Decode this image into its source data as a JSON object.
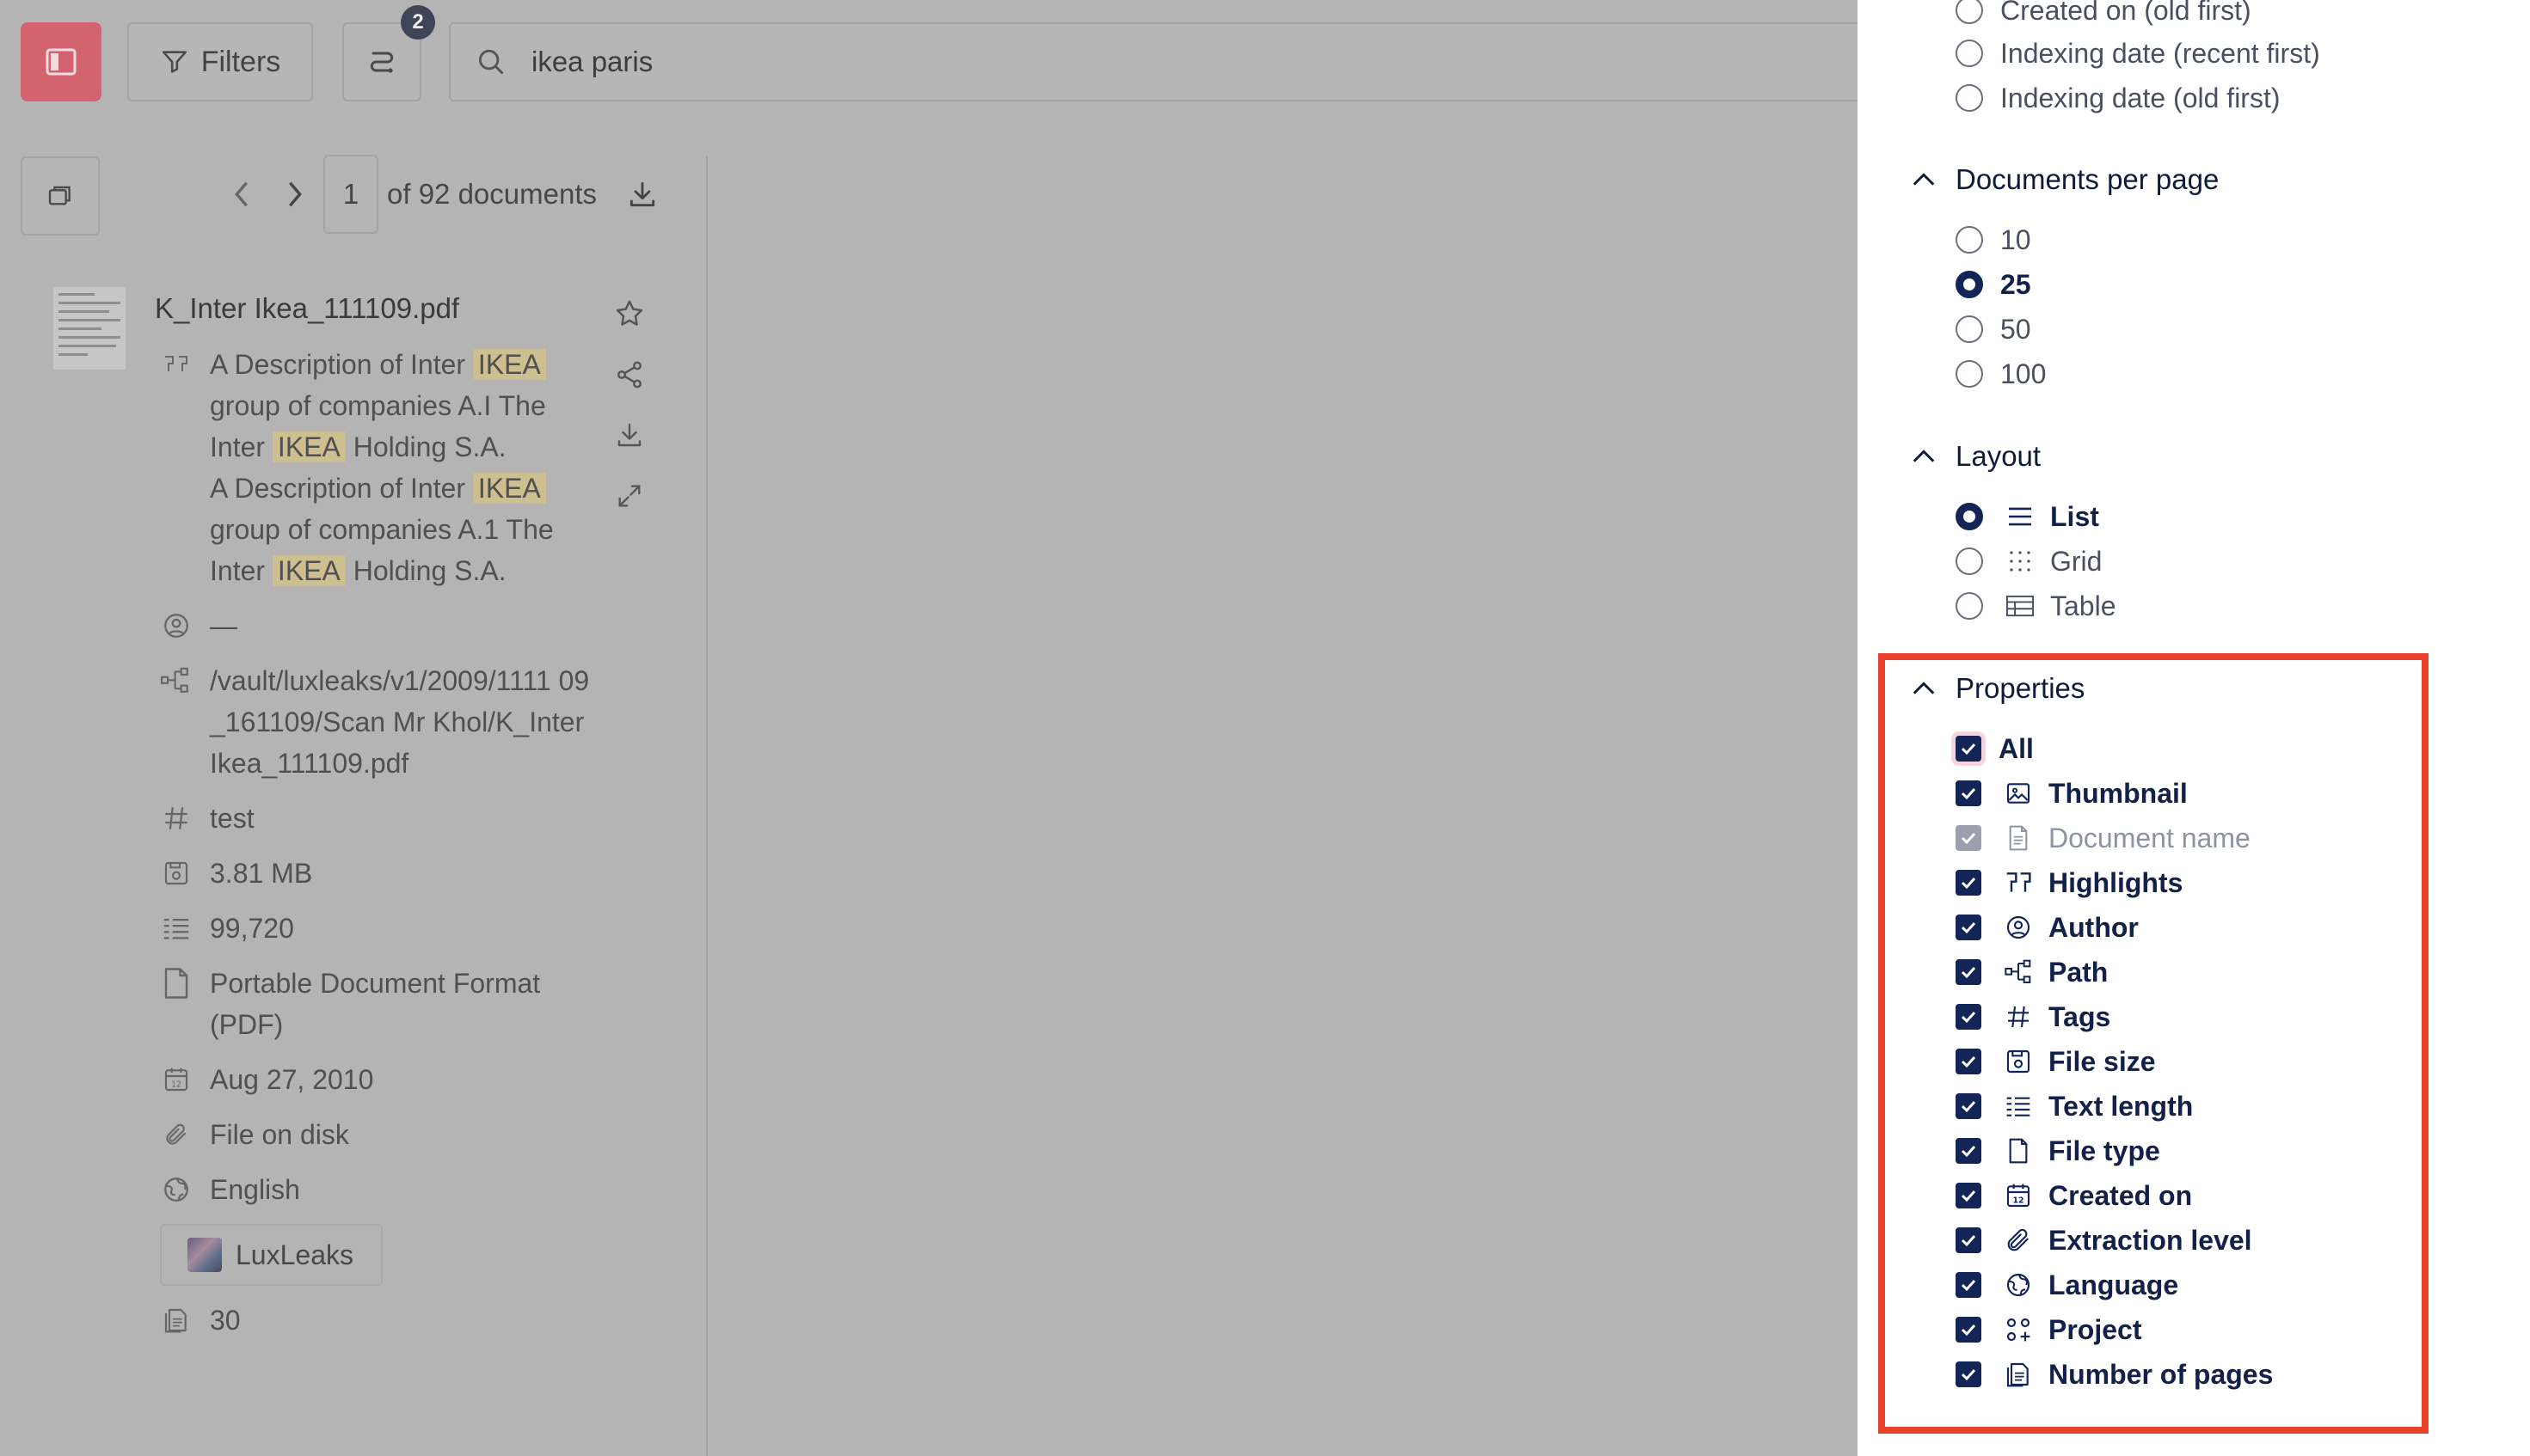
{
  "toolbar": {
    "filters_label": "Filters",
    "sort_badge": "2",
    "search_value": "ikea paris"
  },
  "pager": {
    "page": "1",
    "of_label": "of 92 documents"
  },
  "document": {
    "title": "K_Inter Ikea_111109.pdf",
    "highlight_lines": [
      {
        "before": "A Description of Inter ",
        "hl": "IKEA",
        "after": ""
      },
      {
        "before": "group of companies A.I The",
        "hl": "",
        "after": ""
      },
      {
        "before": "Inter ",
        "hl": "IKEA",
        "after": " Holding S.A."
      },
      {
        "before": "A Description of Inter ",
        "hl": "IKEA",
        "after": ""
      },
      {
        "before": "group of companies A.1 The",
        "hl": "",
        "after": ""
      },
      {
        "before": "Inter ",
        "hl": "IKEA",
        "after": " Holding S.A."
      }
    ],
    "author": "—",
    "path": "/vault/luxleaks/v1/2009/1111 09_161109/Scan Mr Khol/K_Inter Ikea_111109.pdf",
    "tags": "test",
    "file_size": "3.81 MB",
    "text_length": "99,720",
    "file_type": "Portable Document Format (PDF)",
    "created_on": "Aug 27, 2010",
    "extraction_level": "File on disk",
    "language": "English",
    "project": "LuxLeaks",
    "pages": "30"
  },
  "panel": {
    "sort_options": [
      {
        "label": "Created on (old first)",
        "selected": false
      },
      {
        "label": "Indexing date (recent first)",
        "selected": false
      },
      {
        "label": "Indexing date (old first)",
        "selected": false
      }
    ],
    "per_page": {
      "title": "Documents per page",
      "options": [
        {
          "label": "10",
          "selected": false
        },
        {
          "label": "25",
          "selected": true
        },
        {
          "label": "50",
          "selected": false
        },
        {
          "label": "100",
          "selected": false
        }
      ]
    },
    "layout": {
      "title": "Layout",
      "options": [
        {
          "label": "List",
          "icon": "list-icon",
          "selected": true
        },
        {
          "label": "Grid",
          "icon": "grid-icon",
          "selected": false
        },
        {
          "label": "Table",
          "icon": "table-icon",
          "selected": false
        }
      ]
    },
    "properties": {
      "title": "Properties",
      "all_label": "All",
      "items": [
        {
          "label": "Thumbnail",
          "icon": "image-icon",
          "checked": true,
          "disabled": false
        },
        {
          "label": "Document name",
          "icon": "file-text-icon",
          "checked": true,
          "disabled": true
        },
        {
          "label": "Highlights",
          "icon": "quote-icon",
          "checked": true,
          "disabled": false
        },
        {
          "label": "Author",
          "icon": "user-circle-icon",
          "checked": true,
          "disabled": false
        },
        {
          "label": "Path",
          "icon": "tree-icon",
          "checked": true,
          "disabled": false
        },
        {
          "label": "Tags",
          "icon": "hash-icon",
          "checked": true,
          "disabled": false
        },
        {
          "label": "File size",
          "icon": "floppy-icon",
          "checked": true,
          "disabled": false
        },
        {
          "label": "Text length",
          "icon": "text-lines-icon",
          "checked": true,
          "disabled": false
        },
        {
          "label": "File type",
          "icon": "file-icon",
          "checked": true,
          "disabled": false
        },
        {
          "label": "Created on",
          "icon": "calendar-icon",
          "checked": true,
          "disabled": false
        },
        {
          "label": "Extraction level",
          "icon": "paperclip-icon",
          "checked": true,
          "disabled": false
        },
        {
          "label": "Language",
          "icon": "globe-icon",
          "checked": true,
          "disabled": false
        },
        {
          "label": "Project",
          "icon": "apps-icon",
          "checked": true,
          "disabled": false
        },
        {
          "label": "Number of pages",
          "icon": "pages-icon",
          "checked": true,
          "disabled": false
        }
      ]
    }
  },
  "colors": {
    "accent": "#132557",
    "toggle": "#d2636f",
    "highlight_frame": "#e8412c",
    "overlay": "#b4b4b4"
  }
}
